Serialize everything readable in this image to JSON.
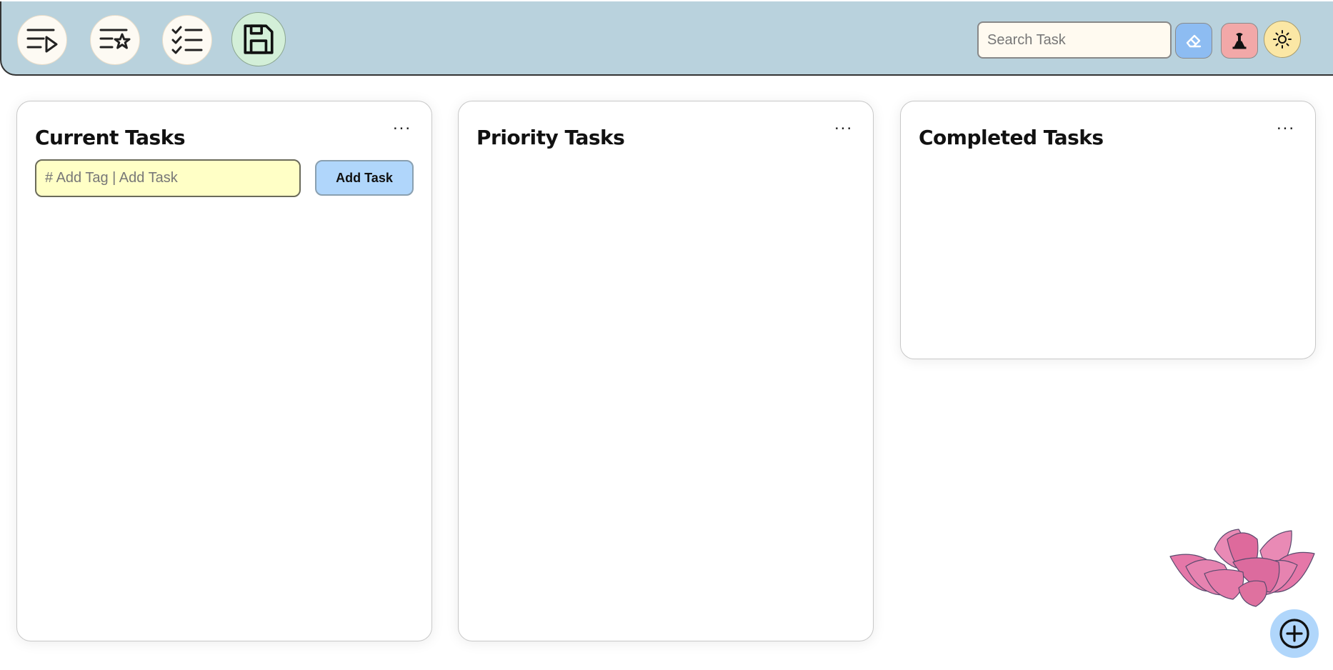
{
  "nav": {
    "current_icon": "current-tasks-icon",
    "priority_icon": "priority-tasks-icon",
    "completed_icon": "completed-tasks-icon",
    "save_icon": "save-icon"
  },
  "search": {
    "placeholder": "Search Task",
    "value": ""
  },
  "tools": {
    "clear_color": "#8dbcf2",
    "clear_icon": "eraser-icon",
    "danger_color": "#f2a8a8",
    "danger_icon": "nuke-icon",
    "theme_color": "#fbe7a5",
    "theme_icon": "sun-icon"
  },
  "columns": [
    {
      "title": "Current Tasks",
      "menu": "...",
      "input_placeholder": "# Add Tag | Add Task",
      "input_value": "",
      "add_button": "Add Task"
    },
    {
      "title": "Priority Tasks",
      "menu": "..."
    },
    {
      "title": "Completed Tasks",
      "menu": "..."
    }
  ],
  "decor": {
    "lotus_icon": "lotus-icon"
  },
  "fab": {
    "icon": "plus-circle-icon"
  }
}
